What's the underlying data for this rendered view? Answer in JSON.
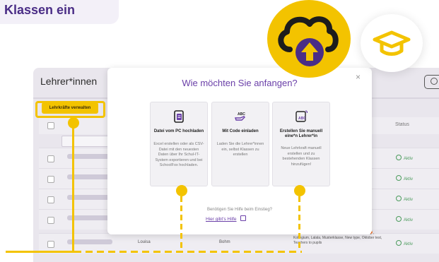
{
  "header_label": "Klassen ein",
  "app": {
    "title": "Lehrer*innen",
    "manage_button": "Lehrkräfte verwalten",
    "status_header": "Status",
    "rows": [
      {
        "status": "Aktiv"
      },
      {
        "status": "Aktiv"
      },
      {
        "status": "Aktiv"
      },
      {
        "status": "Aktiv"
      },
      {
        "first_name": "Louisa",
        "last_name": "Bohm",
        "classes": "1B, 1A, 1A (Usability Test - don't delete), Foxies 🦊, Kollegium, Lalala, Musterklasse, New type, Oktober test, Teachers to pupils",
        "status": "Aktiv"
      }
    ]
  },
  "modal": {
    "title": "Wie möchten Sie anfangen?",
    "close": "×",
    "cards": [
      {
        "title": "Datei vom PC hochladen",
        "description": "Excel erstellen oder als CSV-Datei mit den neuesten Daten über Ihr Schul-IT-System exportieren und bei SchoolFox hochladen.",
        "icon": "file-upload-icon"
      },
      {
        "title": "Mit Code einladen",
        "description": "Laden Sie die Lehrer*innen ein, selbst Klassen zu erstellen",
        "icon": "invite-code-icon"
      },
      {
        "title": "Erstellen Sie manuell eine*n Lehrer*in",
        "description": "Neue Lehrkraft manuell erstellen und zu bestehenden Klassen hinzufügen!",
        "icon": "manual-create-icon"
      }
    ],
    "help_question": "Benötigen Sie Hilfe beim Einstieg?",
    "help_link": "Hier gibt's Hilfe"
  },
  "colors": {
    "accent_yellow": "#f3c300",
    "brand_purple": "#4a2d86",
    "link_purple": "#6a3fa8"
  }
}
